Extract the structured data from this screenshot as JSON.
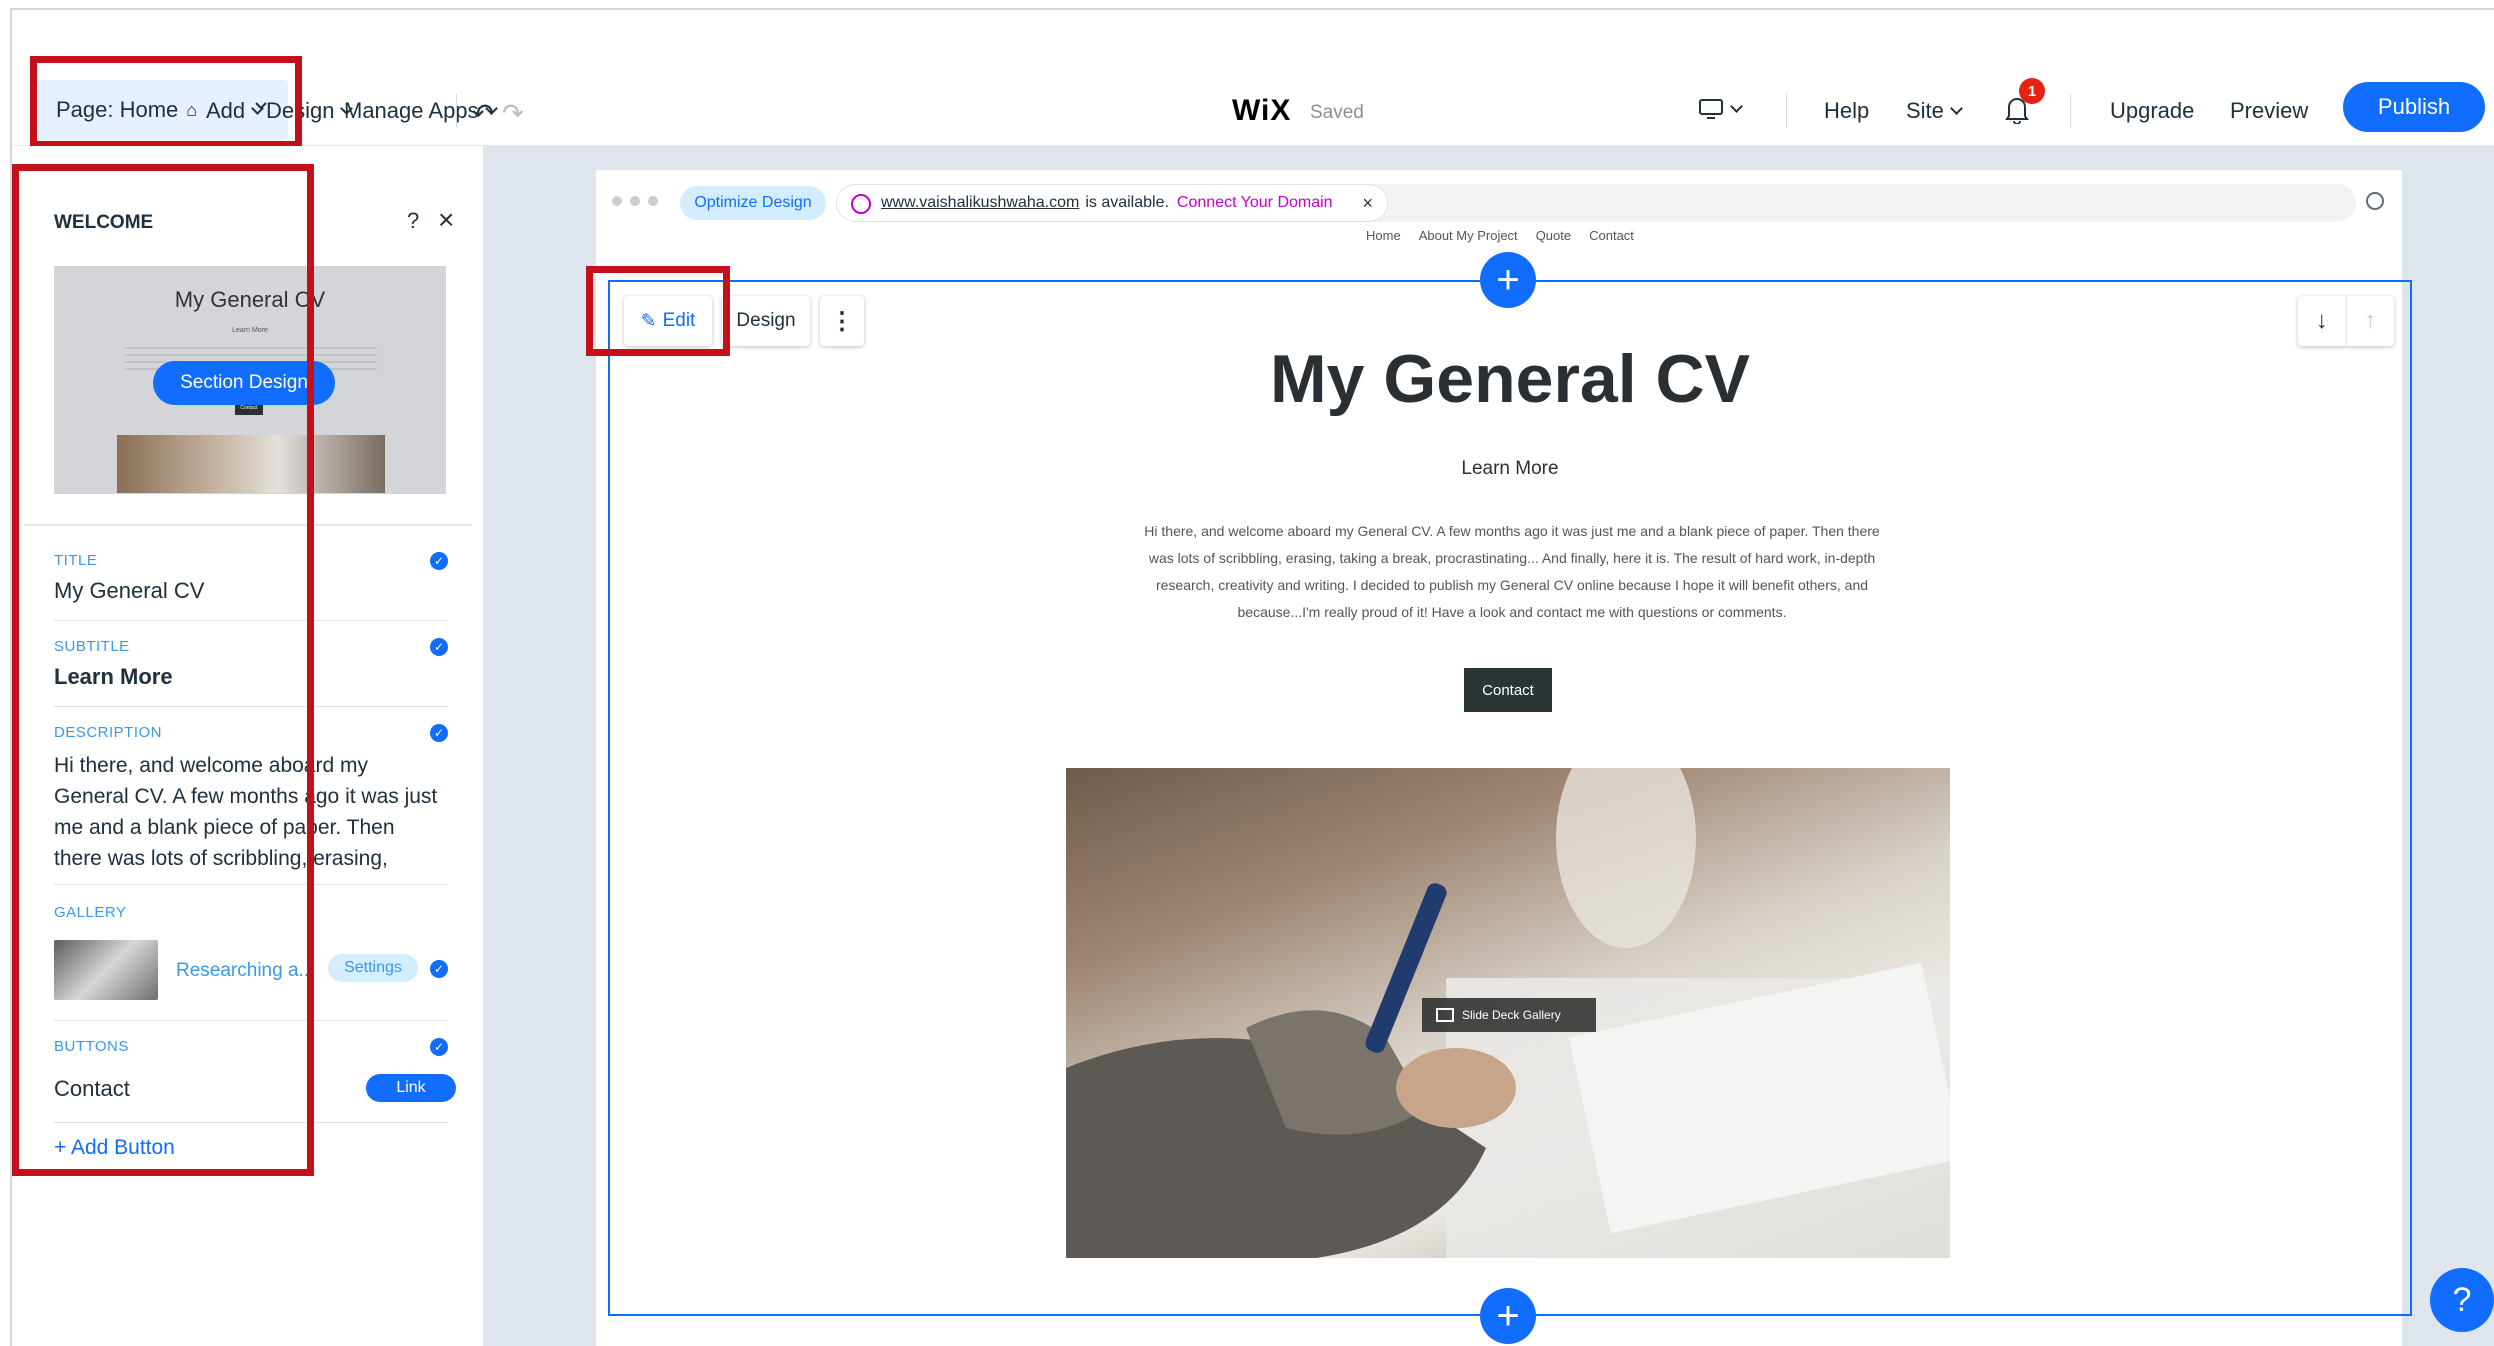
{
  "topbar": {
    "page_select": "Page: Home",
    "menu": {
      "add": "Add",
      "design": "Design",
      "manage_apps": "Manage Apps"
    },
    "logo": "WiX",
    "saved": "Saved",
    "help": "Help",
    "site": "Site",
    "notification_count": "1",
    "upgrade": "Upgrade",
    "preview": "Preview",
    "publish": "Publish"
  },
  "panel": {
    "title": "WELCOME",
    "help": "?",
    "thumbnail": {
      "title": "My General CV",
      "subtitle": "Learn More",
      "button": "Section Design",
      "contact": "Contact"
    },
    "fields": {
      "title_label": "TITLE",
      "title_value": "My General CV",
      "subtitle_label": "SUBTITLE",
      "subtitle_value": "Learn More",
      "description_label": "DESCRIPTION",
      "description_value": "Hi there, and welcome aboard my General CV. A few months ago it was just me and a blank piece of paper. Then there was lots of scribbling, erasing,",
      "gallery_label": "GALLERY",
      "gallery_item": "Researching a...",
      "gallery_settings": "Settings",
      "buttons_label": "BUTTONS",
      "button_name": "Contact",
      "button_link": "Link",
      "add_button": "Add Button"
    }
  },
  "browser": {
    "optimize": "Optimize Design",
    "domain": "www.vaishalikushwaha.com",
    "available": "is available.",
    "connect": "Connect Your Domain",
    "close": "×"
  },
  "site_nav": [
    "Home",
    "About My Project",
    "Quote",
    "Contact"
  ],
  "toolbar": {
    "edit": "Edit",
    "design": "Design",
    "more": "⋮"
  },
  "hero": {
    "title": "My General CV",
    "subtitle": "Learn More",
    "description": "Hi there, and welcome aboard my General CV. A few months ago it was just me and a blank piece of paper. Then there was lots of scribbling, erasing, taking a break, procrastinating... And finally, here it is. The result of hard work, in-depth research, creativity and writing. I decided to publish my General CV online because I hope it will benefit others, and because...I'm really proud of it! Have a look and contact me with questions or comments.",
    "contact_button": "Contact",
    "gallery_tag": "Slide Deck Gallery"
  },
  "help_fab": "?"
}
